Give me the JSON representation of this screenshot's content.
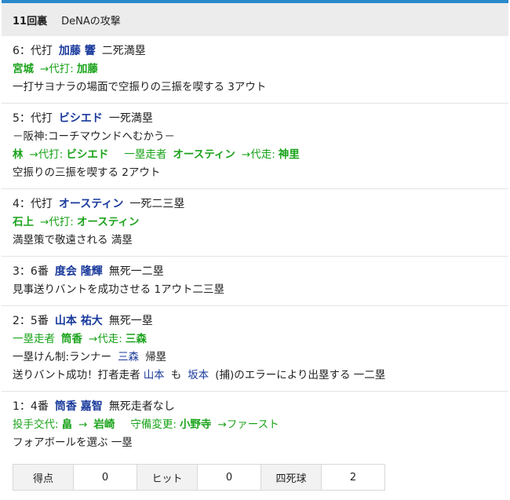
{
  "header": {
    "inning": "11回裏",
    "team_attack": "DeNAの攻撃"
  },
  "plays": [
    {
      "head": {
        "num": "6：",
        "order": "代打",
        "batter": "加藤 響",
        "situation": "二死満塁"
      },
      "sub": {
        "from": "宮城",
        "arrow_label": "→代打:",
        "to": "加藤"
      },
      "result": "一打サヨナラの場面で空振りの三振を喫する 3アウト"
    },
    {
      "head": {
        "num": "5：",
        "order": "代打",
        "batter": "ビシエド",
        "situation": "一死満塁"
      },
      "event": "－阪神:コーチマウンドへむかう－",
      "sub": {
        "from": "林",
        "arrow_label": "→代打:",
        "to": "ビシエド"
      },
      "sub2": {
        "label": "一塁走者",
        "from": "オースティン",
        "arrow_label": "→代走:",
        "to": "神里"
      },
      "result": "空振りの三振を喫する 2アウト"
    },
    {
      "head": {
        "num": "4：",
        "order": "代打",
        "batter": "オースティン",
        "situation": "一死二三塁"
      },
      "sub": {
        "from": "石上",
        "arrow_label": "→代打:",
        "to": "オースティン"
      },
      "result": "満塁策で敬遠される 満塁"
    },
    {
      "head": {
        "num": "3：",
        "order": "6番",
        "batter": "度会 隆輝",
        "situation": "無死一二塁"
      },
      "result": "見事送りバントを成功させる 1アウト二三塁"
    },
    {
      "head": {
        "num": "2：",
        "order": "5番",
        "batter": "山本 祐大",
        "situation": "無死一塁"
      },
      "sub": {
        "label": "一塁走者",
        "from": "筒香",
        "arrow_label": "→代走:",
        "to": "三森"
      },
      "event2": {
        "text": "一塁けん制:ランナー",
        "runner": "三森",
        "after": "帰塁"
      },
      "result_parts": {
        "t1": "送りバント成功！打者走者",
        "n1": "山本",
        "t2": "も",
        "n2": "坂本",
        "t3": "(捕)のエラーにより出塁する 一二塁"
      }
    },
    {
      "head": {
        "num": "1：",
        "order": "4番",
        "batter": "筒香 嘉智",
        "situation": "無死走者なし"
      },
      "pitch_change": {
        "label": "投手交代:",
        "from": "畠",
        "arrow": "→",
        "to": "岩崎"
      },
      "def_change": {
        "label": "守備変更:",
        "player": "小野寺",
        "arrow_label": "→ファースト"
      },
      "result": "フォアボールを選ぶ 一塁"
    }
  ],
  "stats": {
    "runs_label": "得点",
    "runs": "0",
    "hits_label": "ヒット",
    "hits": "0",
    "walks_label": "四死球",
    "walks": "2"
  }
}
